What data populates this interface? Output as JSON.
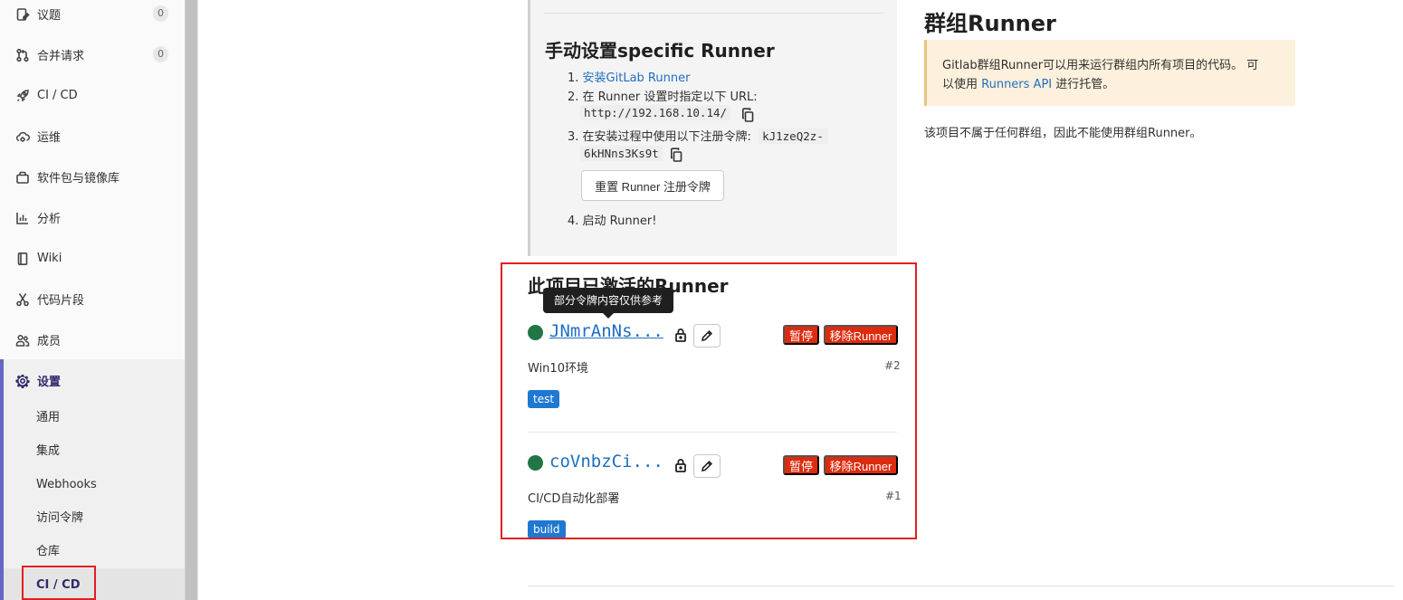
{
  "sidebar": {
    "items": [
      {
        "label": "议题",
        "count": "0"
      },
      {
        "label": "合并请求",
        "count": "0"
      },
      {
        "label": "CI / CD"
      },
      {
        "label": "运维"
      },
      {
        "label": "软件包与镜像库"
      },
      {
        "label": "分析"
      },
      {
        "label": "Wiki"
      },
      {
        "label": "代码片段"
      },
      {
        "label": "成员"
      }
    ],
    "settings_label": "设置",
    "settings_sub": [
      "通用",
      "集成",
      "Webhooks",
      "访问令牌",
      "仓库",
      "CI / CD"
    ]
  },
  "manual": {
    "title": "手动设置specific Runner",
    "step1_num": "1.",
    "step1_link": "安装GitLab Runner",
    "step2_num": "2.",
    "step2_text": "在 Runner 设置时指定以下 URL:",
    "url": "http://192.168.10.14/",
    "step3_num": "3.",
    "step3_text": "在安装过程中使用以下注册令牌:",
    "token_part1": "kJ1zeQ2z-",
    "token_part2": "6kHNns3Ks9t",
    "reset_button": "重置 Runner 注册令牌",
    "step4_num": "4.",
    "step4_text": "启动 Runner!"
  },
  "active_runners": {
    "title": "此项目已激活的Runner",
    "tooltip": "部分令牌内容仅供参考",
    "runners": [
      {
        "token": "JNmrAnNs...",
        "pause": "暂停",
        "remove": "移除Runner",
        "description": "Win10环境",
        "id": "#2",
        "tag": "test"
      },
      {
        "token": "coVnbzCi...",
        "pause": "暂停",
        "remove": "移除Runner",
        "description": "CI/CD自动化部署",
        "id": "#1",
        "tag": "build"
      }
    ]
  },
  "group_runner": {
    "title": "群组Runner",
    "notice_line1_a": "Gitlab群组Runner可以用来运行群组内所有项目的代码。 可",
    "notice_line2_a": "以使用 ",
    "notice_link": "Runners API",
    "notice_line2_b": " 进行托管。",
    "note": "该项目不属于任何群组，因此不能使用群组Runner。"
  },
  "colors": {
    "accent": "#6666c4",
    "link": "#1f6fbf",
    "danger": "#dd2b0e",
    "tag": "#1f78d1",
    "online": "#217645",
    "highlight_box": "#e02020"
  }
}
